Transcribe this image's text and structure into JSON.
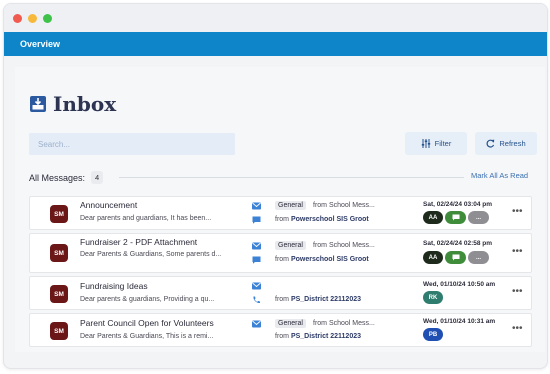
{
  "window": {
    "dots": [
      "#f05a4f",
      "#f6b93b",
      "#3fc24a"
    ]
  },
  "nav": {
    "tab_label": "Overview"
  },
  "page": {
    "title": "Inbox",
    "icon": "inbox-tray-icon"
  },
  "search": {
    "placeholder": "Search..."
  },
  "toolbar": {
    "filter_label": "Filter",
    "refresh_label": "Refresh",
    "filter_icon": "sliders-icon",
    "refresh_icon": "refresh-icon"
  },
  "summary": {
    "label": "All Messages:",
    "count": "4",
    "mark_all_label": "Mark All As Read"
  },
  "messages": [
    {
      "sender": "SM",
      "subject": "Announcement",
      "preview": "Dear parents and guardians, It has been...",
      "channels": [
        "email-icon",
        "chat-icon"
      ],
      "type": "General",
      "from_prefix": "from",
      "from_top": "School Mess...",
      "from_bottom": "Powerschool SIS Groot",
      "date": "Sat, 02/24/24 03:04 pm",
      "avatars": [
        {
          "text": "AA",
          "color": "#1e2a1c"
        },
        {
          "text": "chat",
          "color": "#3f8d3a"
        },
        {
          "text": "...",
          "color": "#8e8e93"
        }
      ]
    },
    {
      "sender": "SM",
      "subject": "Fundraiser 2 - PDF Attachment",
      "preview": "Dear Parents & Guardians, Some parents d...",
      "channels": [
        "email-icon",
        "chat-icon"
      ],
      "type": "General",
      "from_prefix": "from",
      "from_top": "School Mess...",
      "from_bottom": "Powerschool SIS Groot",
      "date": "Sat, 02/24/24 02:58 pm",
      "avatars": [
        {
          "text": "AA",
          "color": "#1e2a1c"
        },
        {
          "text": "chat",
          "color": "#3f8d3a"
        },
        {
          "text": "...",
          "color": "#8e8e93"
        }
      ]
    },
    {
      "sender": "SM",
      "subject": "Fundraising Ideas",
      "preview": "Dear parents & guardians, Providing a qu...",
      "channels": [
        "email-icon",
        "phone-icon"
      ],
      "type": "",
      "from_prefix": "from",
      "from_top": "",
      "from_bottom": "PS_District 22112023",
      "date": "Wed, 01/10/24 10:50 am",
      "avatars": [
        {
          "text": "RK",
          "color": "#2f7d6e"
        }
      ]
    },
    {
      "sender": "SM",
      "subject": "Parent Council Open for Volunteers",
      "preview": "Dear Parents & Guardians, This is a remi...",
      "channels": [
        "email-icon"
      ],
      "type": "General",
      "from_prefix": "from",
      "from_top": "School Mess...",
      "from_bottom": "PS_District 22112023",
      "date": "Wed, 01/10/24 10:31 am",
      "avatars": [
        {
          "text": "PB",
          "color": "#1f4fb3"
        }
      ]
    }
  ],
  "row_menu": "•••",
  "colors": {
    "nav": "#0e84c9",
    "sender_badge": "#6b1717",
    "link": "#3a6fb0",
    "title": "#2c3452"
  }
}
